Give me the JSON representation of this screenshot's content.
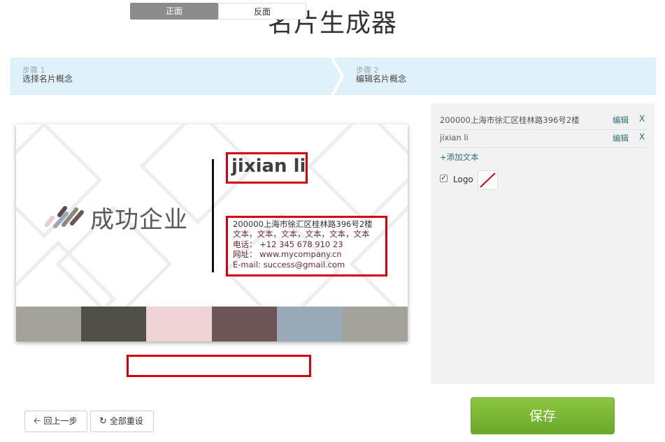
{
  "header": {
    "title": "名片生成器"
  },
  "steps": [
    {
      "num": "步骤 1",
      "name": "选择名片概念"
    },
    {
      "num": "步骤 2",
      "name": "编辑名片概念"
    }
  ],
  "card": {
    "company": "成功企业",
    "name": "jixian li",
    "info_lines": [
      "200000上海市徐汇区桂林路396号2楼",
      "文本，文本，文本，文本，文本，文本",
      "电话： +12 345 678 910 23",
      "网址： www.mycompany.cn",
      "E-mail: success@gmail.com"
    ],
    "stripe_colors": [
      "#a3a39a",
      "#4f4f47",
      "#f0d3d6",
      "#6e5658",
      "#9aa9b8",
      "#a3a39a"
    ],
    "accent_red": "#d9000d"
  },
  "toggle": {
    "front": "正面",
    "back": "反面"
  },
  "buttons": {
    "back": "回上一步",
    "reset": "全部重设",
    "save": "保存"
  },
  "panel": {
    "fields": [
      {
        "value": "200000上海市徐汇区桂林路396号2楼",
        "edit": "编辑",
        "delete": "X"
      },
      {
        "value": "jixian li",
        "edit": "编辑",
        "delete": "X"
      }
    ],
    "add_text": "+添加文本",
    "logo_label": "Logo",
    "logo_checked": true
  },
  "colors": {
    "save_green": "#7ab833",
    "link_teal": "#2f6f74",
    "steps_bg": "#dff2fb"
  }
}
